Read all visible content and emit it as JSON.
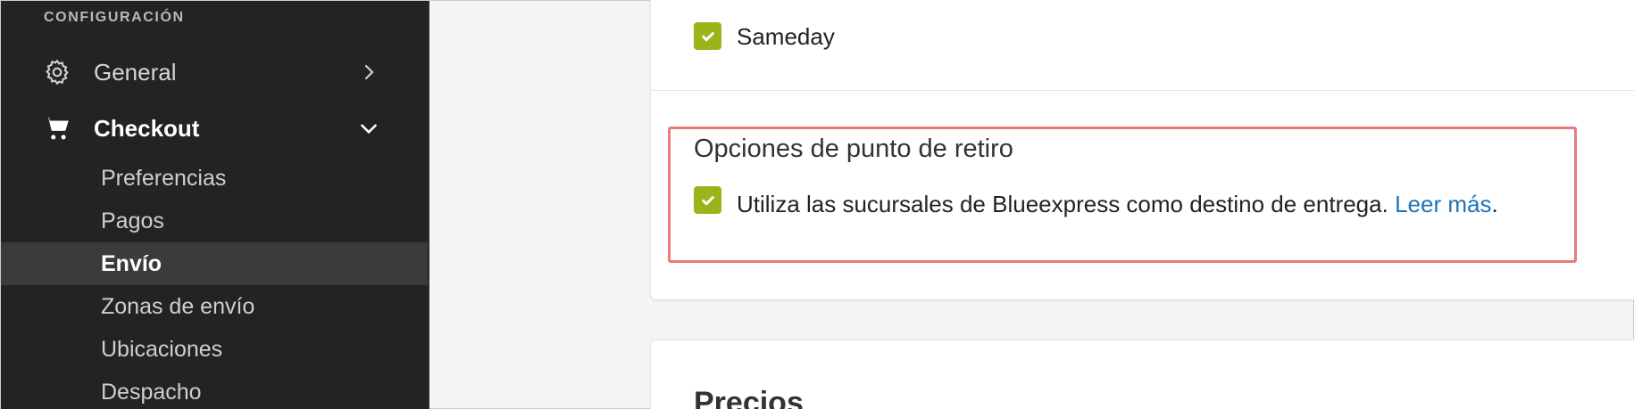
{
  "sidebar": {
    "section_title": "CONFIGURACIÓN",
    "items": [
      {
        "label": "General",
        "icon": "gear-icon",
        "chevron": "chevron-right-icon"
      },
      {
        "label": "Checkout",
        "icon": "cart-icon",
        "chevron": "chevron-down-icon"
      }
    ],
    "subitems": [
      {
        "label": "Preferencias"
      },
      {
        "label": "Pagos"
      },
      {
        "label": "Envío"
      },
      {
        "label": "Zonas de envío"
      },
      {
        "label": "Ubicaciones"
      },
      {
        "label": "Despacho"
      }
    ]
  },
  "main": {
    "sameday_label": "Sameday",
    "pickup": {
      "heading": "Opciones de punto de retiro",
      "text": "Utiliza las sucursales de Blueexpress como destino de entrega.",
      "link": "Leer más",
      "trailing": "."
    },
    "prices_heading": "Precios"
  },
  "colors": {
    "sidebar_bg": "#232323",
    "checkbox": "#9ab51a",
    "link": "#1f73b7",
    "highlight": "#e67c7c"
  }
}
